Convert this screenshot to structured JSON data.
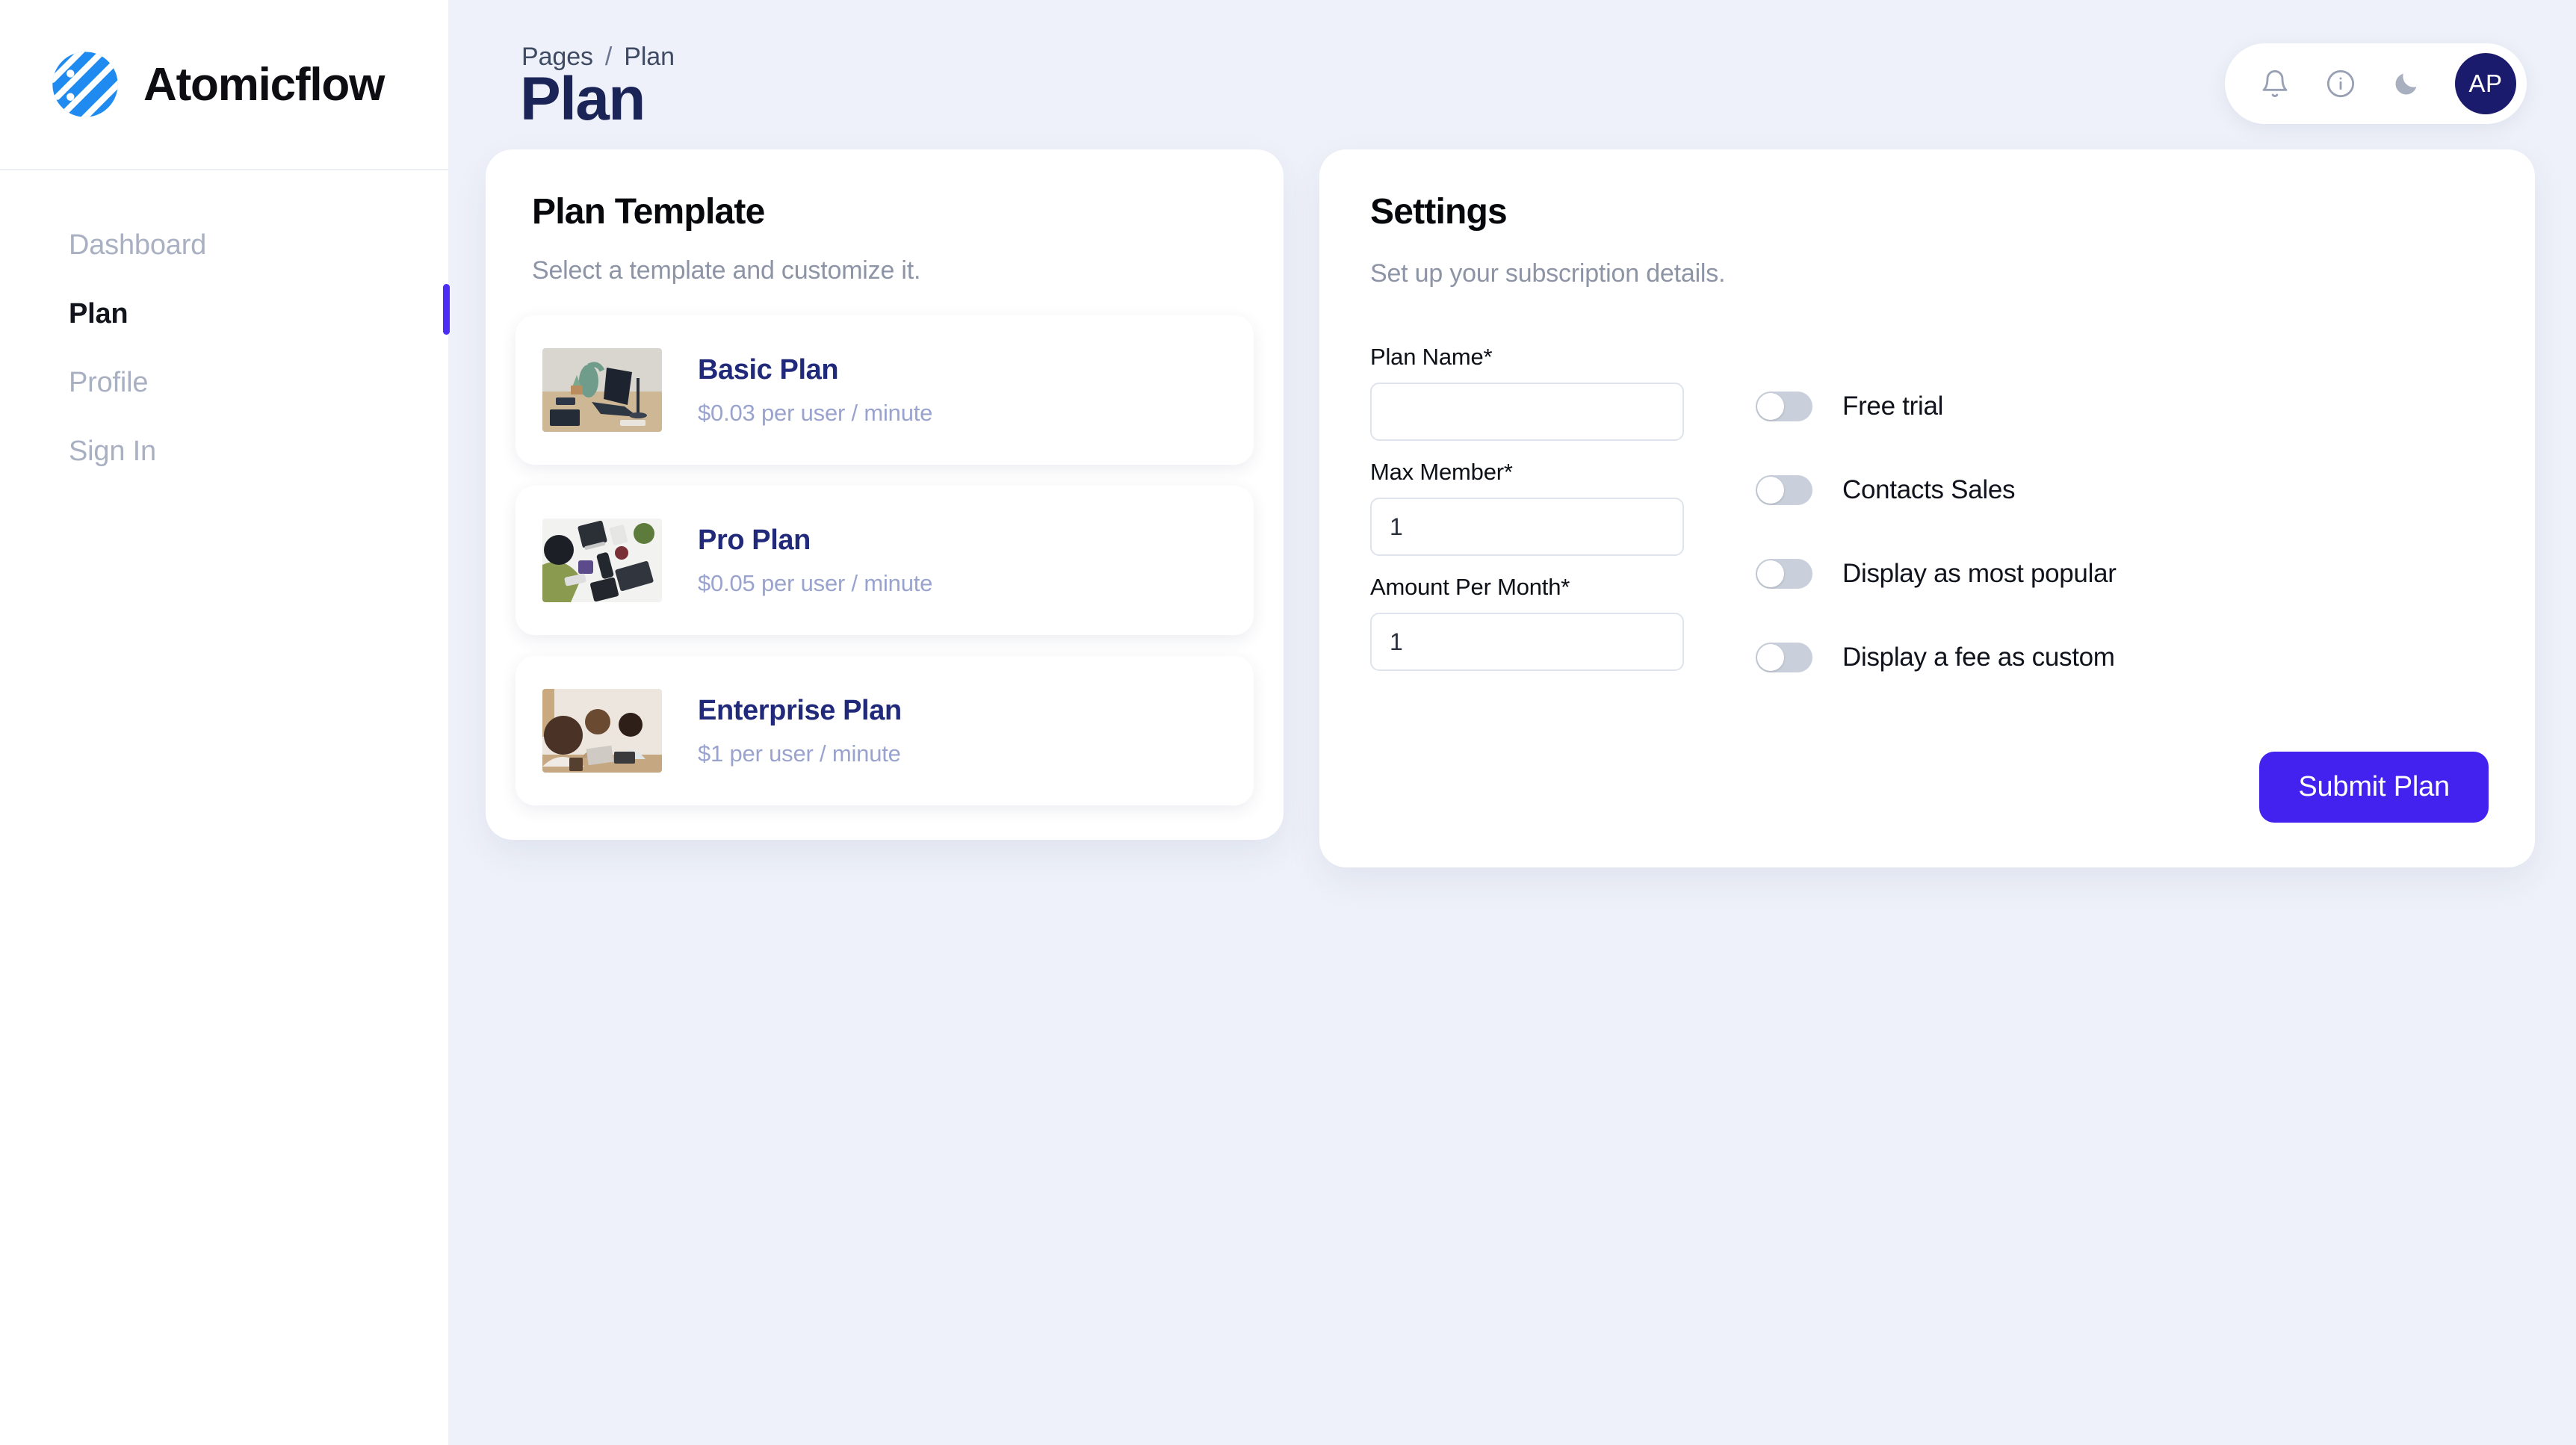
{
  "sidebar": {
    "brand": {
      "name": "Atomicflow",
      "logo_icon": "globe-stripes-icon"
    },
    "items": [
      {
        "label": "Dashboard",
        "active": false
      },
      {
        "label": "Plan",
        "active": true
      },
      {
        "label": "Profile",
        "active": false
      },
      {
        "label": "Sign In",
        "active": false
      }
    ]
  },
  "header": {
    "breadcrumb": {
      "parent": "Pages",
      "separator": "/",
      "current": "Plan"
    },
    "title": "Plan",
    "actions": {
      "notifications_icon": "bell-icon",
      "info_icon": "info-circle-icon",
      "theme_icon": "moon-icon",
      "avatar_initials": "AP"
    }
  },
  "plan_template": {
    "title": "Plan Template",
    "subtitle": "Select a template and customize it.",
    "plans": [
      {
        "name": "Basic Plan",
        "price": "$0.03 per user / minute",
        "thumb": "workspace-desk-photo"
      },
      {
        "name": "Pro Plan",
        "price": "$0.05 per user / minute",
        "thumb": "gadgets-flatlay-photo"
      },
      {
        "name": "Enterprise Plan",
        "price": "$1 per user / minute",
        "thumb": "team-meeting-photo"
      }
    ]
  },
  "settings": {
    "title": "Settings",
    "subtitle": "Set up your subscription details.",
    "fields": [
      {
        "label": "Plan Name*",
        "value": "",
        "placeholder": ""
      },
      {
        "label": "Max Member*",
        "value": "1",
        "placeholder": ""
      },
      {
        "label": "Amount Per Month*",
        "value": "1",
        "placeholder": ""
      }
    ],
    "toggles": [
      {
        "label": "Free trial",
        "on": false
      },
      {
        "label": "Contacts Sales",
        "on": false
      },
      {
        "label": "Display as most popular",
        "on": false
      },
      {
        "label": "Display a fee as custom",
        "on": false
      }
    ],
    "submit_label": "Submit Plan"
  },
  "colors": {
    "accent": "#4322f0",
    "brand_blue": "#1f8bf0",
    "title_navy": "#1b2456",
    "plan_name": "#20297a",
    "avatar_bg": "#1b1b6e",
    "page_bg": "#eef1f9"
  }
}
